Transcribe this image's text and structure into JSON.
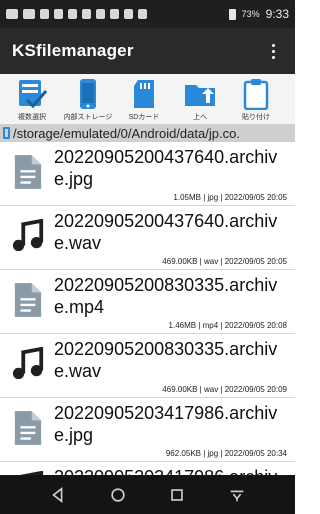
{
  "status_bar": {
    "battery": "73%",
    "time": "9:33"
  },
  "app_bar": {
    "title": "KSfilemanager",
    "more_icon": "more-vert-icon"
  },
  "toolbar": {
    "items": [
      {
        "label": "複数選択",
        "icon": "multi-select-icon"
      },
      {
        "label": "内部ストレージ",
        "icon": "phone-storage-icon"
      },
      {
        "label": "SDカード",
        "icon": "sd-card-icon"
      },
      {
        "label": "上へ",
        "icon": "folder-up-icon"
      },
      {
        "label": "貼り付け",
        "icon": "clipboard-paste-icon"
      }
    ]
  },
  "path": "/storage/emulated/0/Android/data/jp.co.",
  "files": [
    {
      "name": "20220905200437640.archive.jpg",
      "meta": "1.05MB | jpg | 2022/09/05 20:05",
      "icon": "document-icon"
    },
    {
      "name": "20220905200437640.archive.wav",
      "meta": "469.00KB | wav | 2022/09/05 20:05",
      "icon": "music-note-icon"
    },
    {
      "name": "20220905200830335.archive.mp4",
      "meta": "1.46MB | mp4 | 2022/09/05 20:08",
      "icon": "document-icon"
    },
    {
      "name": "20220905200830335.archive.wav",
      "meta": "469.00KB | wav | 2022/09/05 20:09",
      "icon": "music-note-icon"
    },
    {
      "name": "20220905203417986.archive.jpg",
      "meta": "962.05KB | jpg | 2022/09/05 20:34",
      "icon": "document-icon"
    },
    {
      "name": "20220905203417986.archiv",
      "meta": "",
      "icon": "music-note-icon"
    }
  ],
  "colors": {
    "accent_blue": "#2b8ad8",
    "app_bar": "#2a2a2a",
    "status_bar": "#1f1f1f",
    "file_icon_doc": "#8a9aa6",
    "file_icon_music": "#202020"
  }
}
